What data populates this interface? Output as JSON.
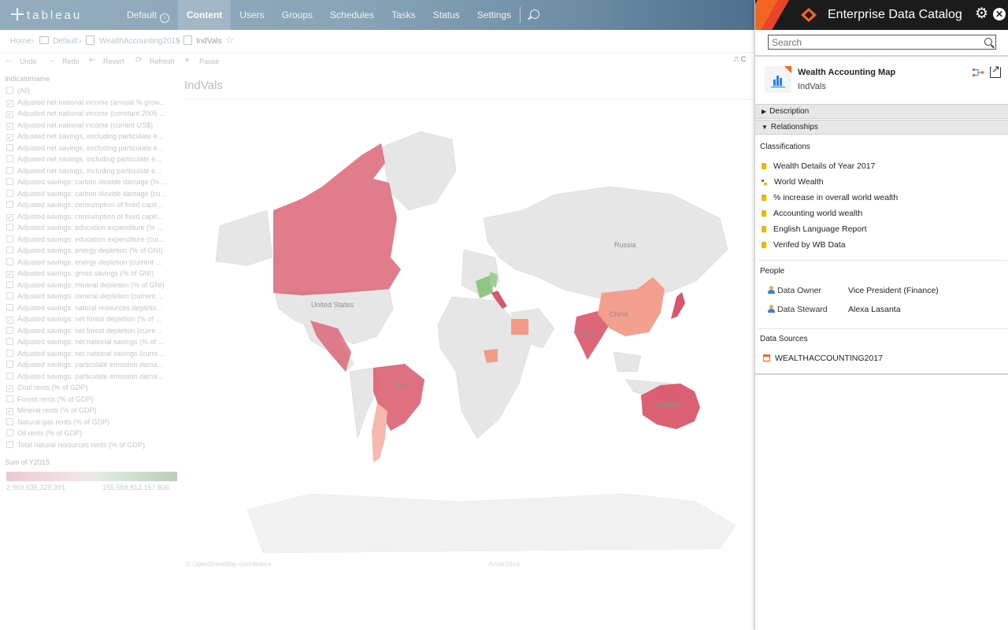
{
  "topnav": {
    "logo": "tableau",
    "site": "Default",
    "tabs": [
      "Content",
      "Users",
      "Groups",
      "Schedules",
      "Tasks",
      "Status",
      "Settings"
    ],
    "active_tab": "Content"
  },
  "breadcrumb": {
    "home": "Home",
    "project": "Default",
    "workbook": "WealthAccounting2015",
    "view": "IndVals"
  },
  "toolbar": {
    "undo": "Undo",
    "redo": "Redo",
    "revert": "Revert",
    "refresh": "Refresh",
    "pause": "Pause"
  },
  "filter": {
    "title": "Indicatorname",
    "items": [
      {
        "label": "(All)",
        "checked": false
      },
      {
        "label": "Adjusted net national income (annual % grow...",
        "checked": true
      },
      {
        "label": "Adjusted net national income (constant 2005 ...",
        "checked": true
      },
      {
        "label": "Adjusted net national income (current US$)",
        "checked": true
      },
      {
        "label": "Adjusted net savings, excluding particulate e...",
        "checked": true
      },
      {
        "label": "Adjusted net savings, excluding particulate e...",
        "checked": false
      },
      {
        "label": "Adjusted net savings, including particulate e...",
        "checked": false
      },
      {
        "label": "Adjusted net savings, including particulate e...",
        "checked": false
      },
      {
        "label": "Adjusted savings: carbon dioxide damage (% ...",
        "checked": false
      },
      {
        "label": "Adjusted savings: carbon dioxide damage (cu...",
        "checked": false
      },
      {
        "label": "Adjusted savings: consumption of fixed capit...",
        "checked": false
      },
      {
        "label": "Adjusted savings: consumption of fixed capit...",
        "checked": true
      },
      {
        "label": "Adjusted savings: education expenditure (% ...",
        "checked": false
      },
      {
        "label": "Adjusted savings: education expenditure (cur...",
        "checked": false
      },
      {
        "label": "Adjusted savings: energy depletion (% of GNI)",
        "checked": false
      },
      {
        "label": "Adjusted savings: energy depletion (current ...",
        "checked": false
      },
      {
        "label": "Adjusted savings: gross savings (% of GNI)",
        "checked": true
      },
      {
        "label": "Adjusted savings: mineral depletion (% of GNI)",
        "checked": false
      },
      {
        "label": "Adjusted savings: mineral depletion (current ...",
        "checked": false
      },
      {
        "label": "Adjusted savings: natural resources depletio...",
        "checked": false
      },
      {
        "label": "Adjusted savings: net forest depletion (% of ...",
        "checked": true
      },
      {
        "label": "Adjusted savings: net forest depletion (curre...",
        "checked": false
      },
      {
        "label": "Adjusted savings: net national savings (% of ...",
        "checked": false
      },
      {
        "label": "Adjusted savings: net national savings (curre...",
        "checked": false
      },
      {
        "label": "Adjusted savings: particulate emission dama...",
        "checked": false
      },
      {
        "label": "Adjusted savings: particulate emission dama...",
        "checked": false
      },
      {
        "label": "Coal rents (% of GDP)",
        "checked": true
      },
      {
        "label": "Forest rents (% of GDP)",
        "checked": false
      },
      {
        "label": "Mineral rents (% of GDP)",
        "checked": true
      },
      {
        "label": "Natural gas rents (% of GDP)",
        "checked": false
      },
      {
        "label": "Oil rents (% of GDP)",
        "checked": false
      },
      {
        "label": "Total natural resources rents (% of GDP)",
        "checked": false
      }
    ],
    "legend_title": "Sum of Y2015",
    "legend_min": "2,969,635,329,991",
    "legend_max": "155,558,812,157,806"
  },
  "viz": {
    "title": "IndVals",
    "credit": "© OpenStreetMap contributors",
    "labels": {
      "russia": "Russia",
      "united_states": "United States",
      "china": "China",
      "india": "India",
      "brazil": "Brazil",
      "australia": "Australia",
      "antarctica": "Antarctica"
    },
    "colors": {
      "land": "#e6e6e6",
      "high": "#d9576a",
      "mid": "#e06d6d",
      "light": "#f29b88",
      "green": "#7fbf74",
      "pale": "#f6b9ae"
    }
  },
  "edc": {
    "title": "Enterprise Data Catalog",
    "search_placeholder": "Search",
    "asset_name": "Wealth Accounting Map",
    "asset_subtitle": "IndVals",
    "sections": {
      "description": "Description",
      "relationships": "Relationships",
      "classifications": "Classifications",
      "people": "People",
      "data_sources": "Data Sources"
    },
    "classifications": [
      "Wealth Details of Year 2017",
      "World Wealth",
      "% increase in overall world wealth",
      "Accounting world wealth",
      "English Language Report",
      "Verifed by WB Data"
    ],
    "people": [
      {
        "role": "Data Owner",
        "name": "Vice President (Finance)"
      },
      {
        "role": "Data Steward",
        "name": "Alexa Lasanta"
      }
    ],
    "data_source": "WEALTHACCOUNTING2017",
    "accent": "#f26522"
  }
}
